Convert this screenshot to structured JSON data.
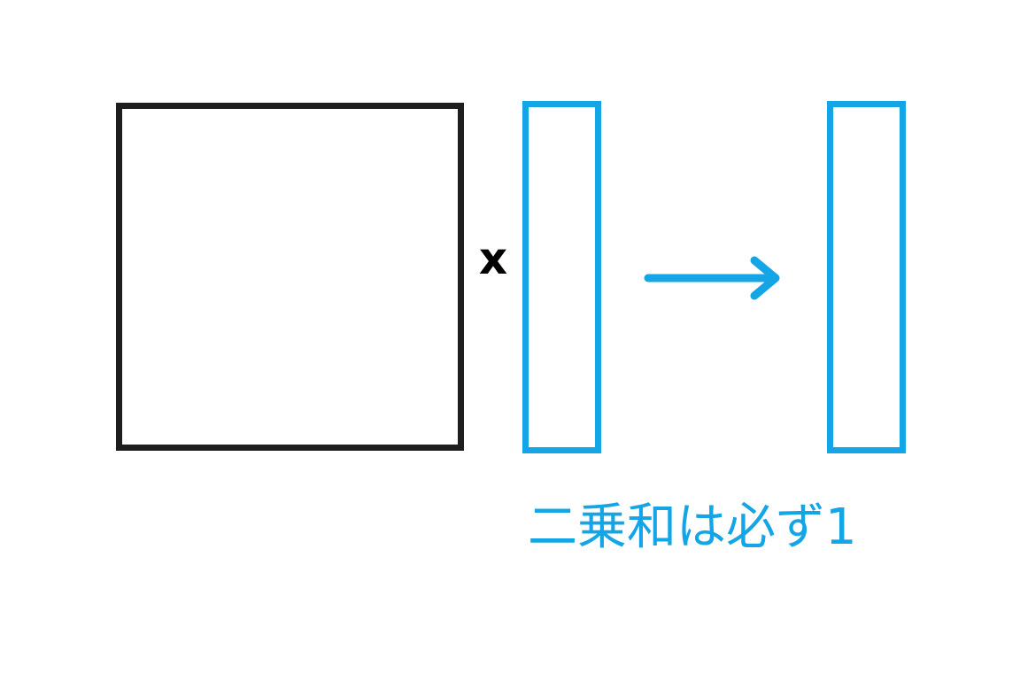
{
  "operator": "x",
  "caption": "二乗和は必ず1",
  "colors": {
    "matrix": "#1e1e1e",
    "vector": "#14a5e6",
    "operator": "#000000"
  },
  "icons": [
    "right-arrow-icon"
  ]
}
